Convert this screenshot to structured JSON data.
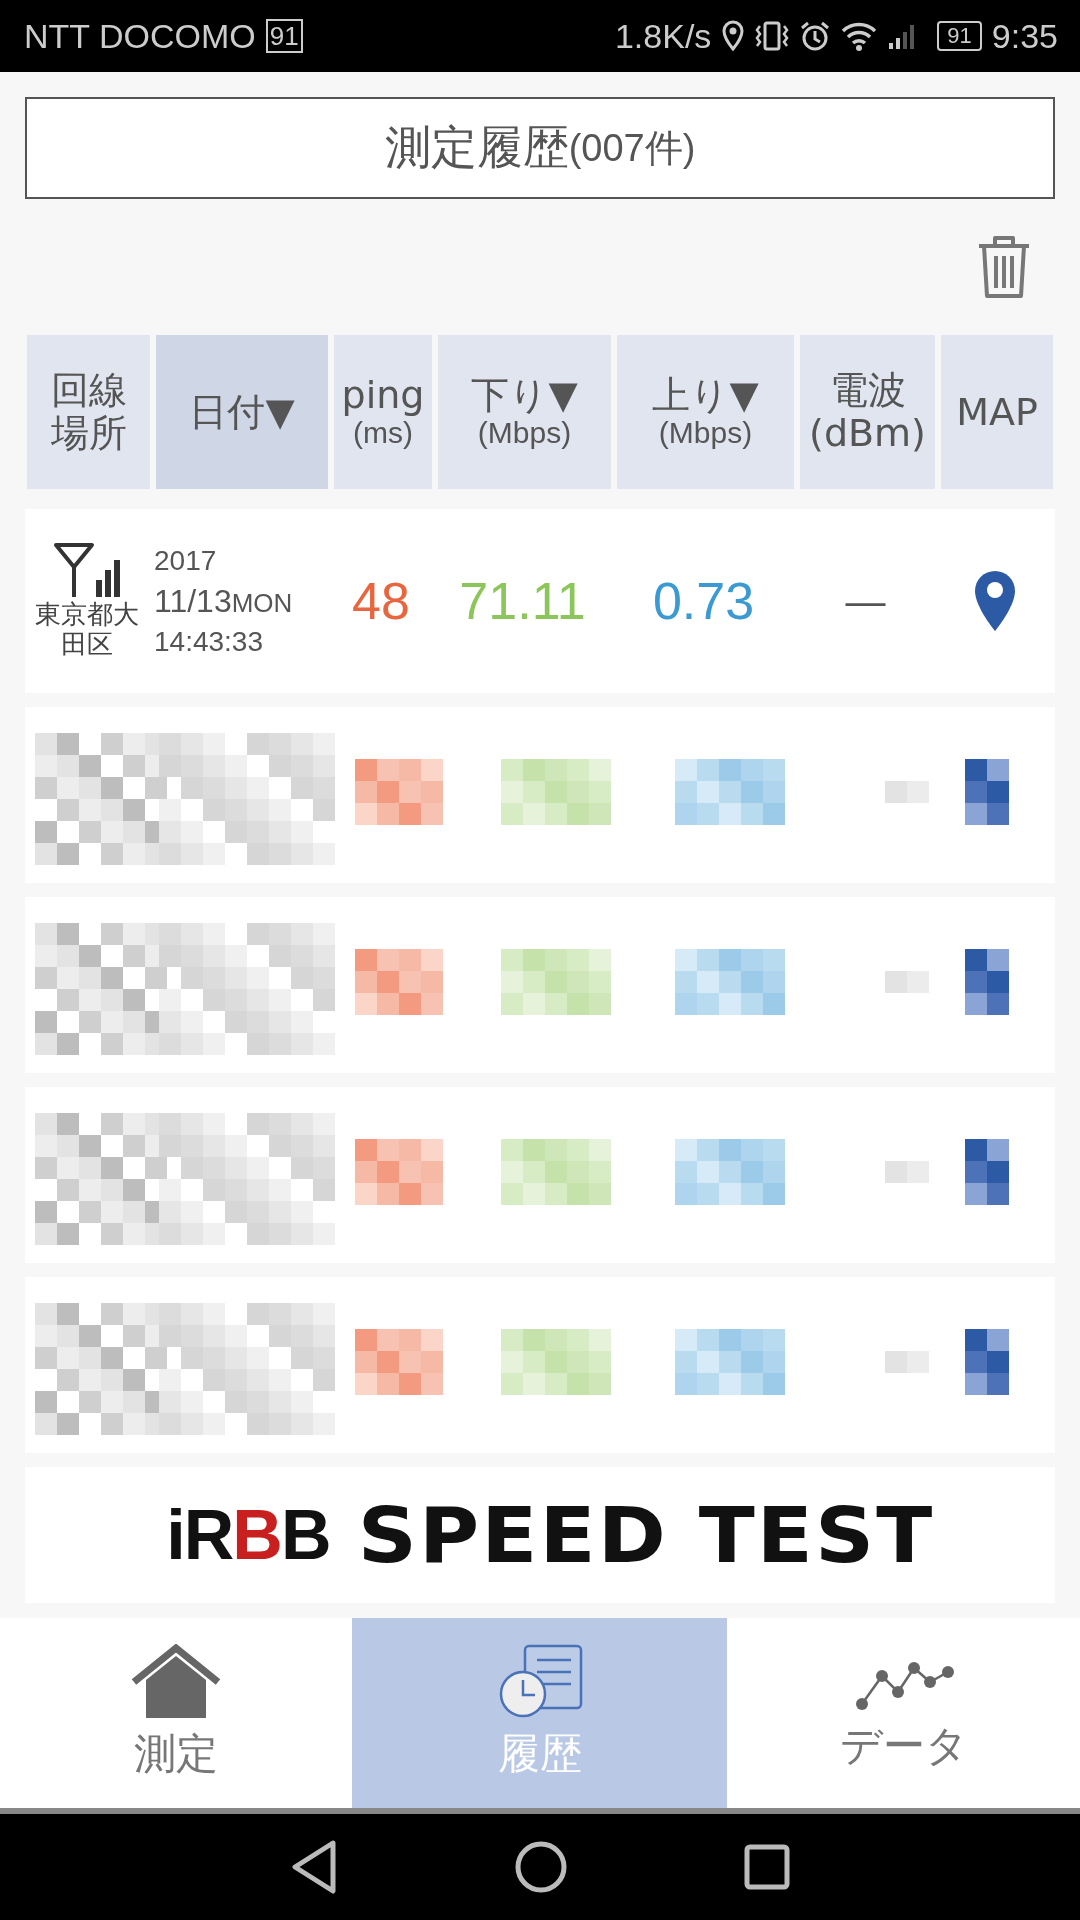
{
  "status_bar": {
    "carrier": "NTT DOCOMO",
    "carrier_badge": "91",
    "speed": "1.8K/s",
    "battery": "91",
    "time": "9:35"
  },
  "title": {
    "main": "測定履歴",
    "count": "(007件)"
  },
  "columns": [
    {
      "lines": [
        "回線",
        "場所"
      ],
      "selected": false
    },
    {
      "lines": [
        "日付▼"
      ],
      "selected": true
    },
    {
      "lines": [
        "ping",
        "(ms)"
      ],
      "selected": false
    },
    {
      "lines": [
        "下り▼",
        "(Mbps)"
      ],
      "selected": false
    },
    {
      "lines": [
        "上り▼",
        "(Mbps)"
      ],
      "selected": false
    },
    {
      "lines": [
        "電波",
        "(dBm)"
      ],
      "selected": false
    },
    {
      "lines": [
        "MAP"
      ],
      "selected": false
    }
  ],
  "rows": [
    {
      "kind": "record",
      "location": "東京都大田区",
      "year": "2017",
      "date": "11/13",
      "weekday": "MON",
      "time": "14:43:33",
      "ping": "48",
      "download": "71.11",
      "upload": "0.73",
      "signal": "—"
    },
    {
      "kind": "blurred"
    },
    {
      "kind": "blurred"
    },
    {
      "kind": "blurred"
    },
    {
      "kind": "blurred"
    }
  ],
  "banner": {
    "brand": [
      {
        "text": "iR",
        "color": "#111111"
      },
      {
        "text": "B",
        "color": "#c8201f"
      },
      {
        "text": "B",
        "color": "#111111"
      }
    ],
    "title": "SPEED TEST"
  },
  "tabs": [
    {
      "kind": "home",
      "label": "測定",
      "selected": false
    },
    {
      "kind": "history",
      "label": "履歴",
      "selected": true
    },
    {
      "kind": "chart",
      "label": "データ",
      "selected": false
    }
  ]
}
